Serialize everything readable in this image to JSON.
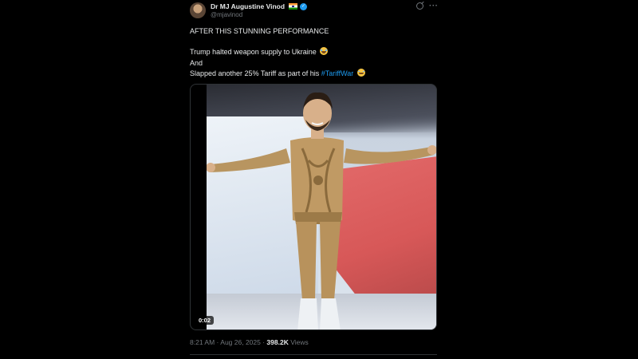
{
  "author": {
    "display_name": "Dr MJ Augustine Vinod",
    "handle": "@mjavinod",
    "flag_icon": "india-flag-icon",
    "verified_icon": "verified-badge-icon"
  },
  "header_icons": {
    "grok": "grok-icon",
    "more": "more-options-icon"
  },
  "tweet": {
    "line1": "AFTER THIS STUNNING PERFORMANCE",
    "line2": "Trump halted weapon supply to Ukraine",
    "line3": "And",
    "line4_prefix": "Slapped another 25% Tariff as part of his ",
    "hashtag": "#TariffWar",
    "emoji": "rolling-on-floor-laughing-emoji"
  },
  "media": {
    "duration": "0:02"
  },
  "meta": {
    "time": "8:21 AM",
    "separator1": " · ",
    "date": "Aug 26, 2025",
    "separator2": " · ",
    "views_count": "398.2K",
    "views_label": " Views"
  },
  "colors": {
    "background": "#000000",
    "text": "#e7e9ea",
    "muted": "#71767b",
    "link": "#1d9bf0"
  }
}
